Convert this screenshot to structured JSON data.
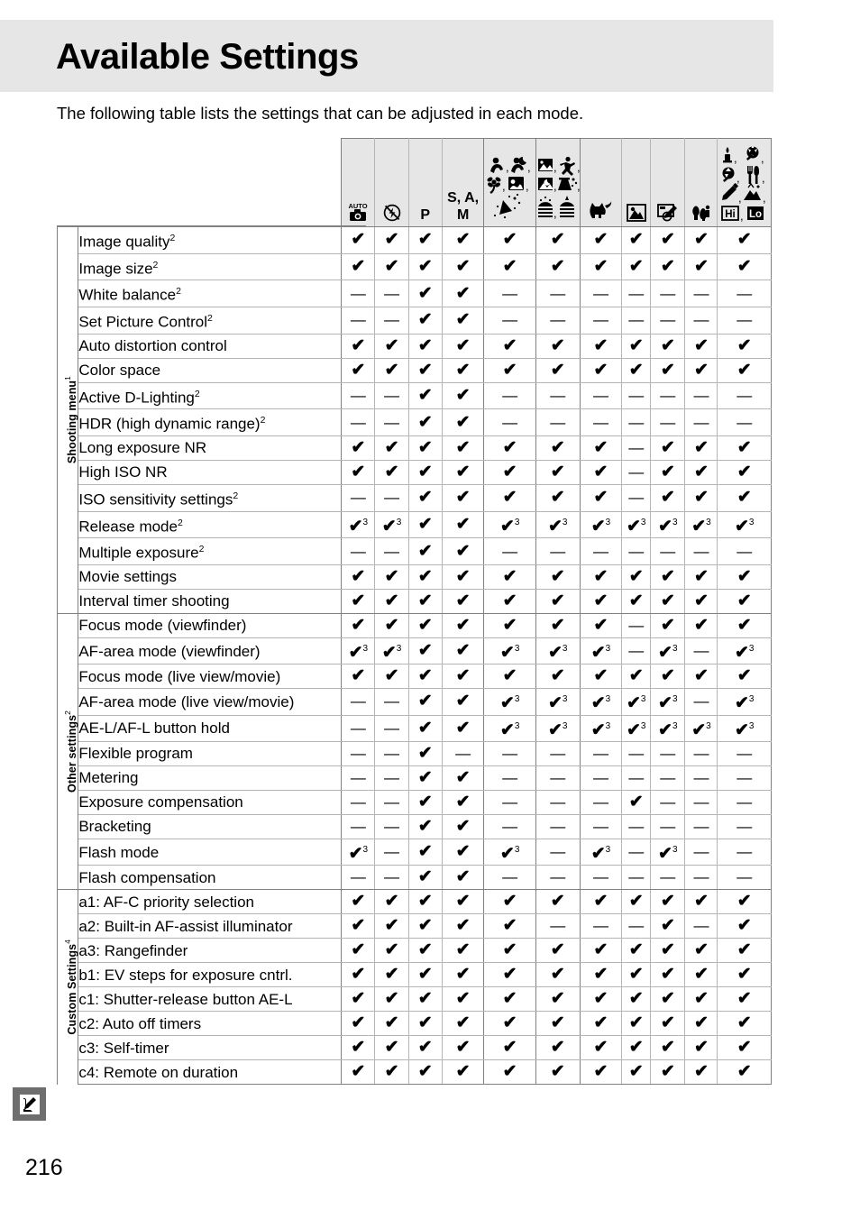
{
  "page": {
    "title": "Available Settings",
    "intro": "The following table lists the settings that can be adjusted in each mode.",
    "number": "216",
    "badge_icon": "pencil-note-icon",
    "accent_band": "#e6e6e6",
    "rule_color": "#808080"
  },
  "table": {
    "columns": [
      {
        "id": "auto",
        "icons": [
          "AUTO camera"
        ],
        "text": ""
      },
      {
        "id": "auto_noflash",
        "icons": [
          "flash-off"
        ],
        "text": ""
      },
      {
        "id": "p",
        "icons": [],
        "text": "P"
      },
      {
        "id": "sam",
        "icons": [],
        "text": "S, A, M"
      },
      {
        "id": "scene1",
        "icons": [
          "portrait",
          "night-portrait",
          "close-up",
          "child",
          "party"
        ],
        "text": ""
      },
      {
        "id": "scene2",
        "icons": [
          "landscape",
          "sports",
          "night-landscape",
          "candlelight",
          "beach",
          "sunset"
        ],
        "text": ""
      },
      {
        "id": "petportrait",
        "icons": [
          "pet-portrait"
        ],
        "text": ""
      },
      {
        "id": "effect_nightvision",
        "icons": [
          "night-vision"
        ],
        "text": ""
      },
      {
        "id": "effect_colorsketch",
        "icons": [
          "color-sketch"
        ],
        "text": ""
      },
      {
        "id": "effect_miniature",
        "icons": [
          "miniature-effect"
        ],
        "text": ""
      },
      {
        "id": "effect_group",
        "icons": [
          "candlelight",
          "blossom",
          "autumn",
          "food",
          "selective-color",
          "silhouette",
          "high-key",
          "low-key"
        ],
        "text": ""
      }
    ],
    "sections": [
      {
        "label": "Shooting menu",
        "label_sup": "1",
        "rows": [
          {
            "name": "Image quality",
            "sup": "2",
            "cells": [
              "y",
              "y",
              "y",
              "y",
              "y",
              "y",
              "y",
              "y",
              "y",
              "y",
              "y"
            ]
          },
          {
            "name": "Image size",
            "sup": "2",
            "cells": [
              "y",
              "y",
              "y",
              "y",
              "y",
              "y",
              "y",
              "y",
              "y",
              "y",
              "y"
            ]
          },
          {
            "name": "White balance",
            "sup": "2",
            "cells": [
              "n",
              "n",
              "y",
              "y",
              "n",
              "n",
              "n",
              "n",
              "n",
              "n",
              "n"
            ]
          },
          {
            "name": "Set Picture Control",
            "sup": "2",
            "cells": [
              "n",
              "n",
              "y",
              "y",
              "n",
              "n",
              "n",
              "n",
              "n",
              "n",
              "n"
            ]
          },
          {
            "name": "Auto distortion control",
            "sup": "",
            "cells": [
              "y",
              "y",
              "y",
              "y",
              "y",
              "y",
              "y",
              "y",
              "y",
              "y",
              "y"
            ]
          },
          {
            "name": "Color space",
            "sup": "",
            "cells": [
              "y",
              "y",
              "y",
              "y",
              "y",
              "y",
              "y",
              "y",
              "y",
              "y",
              "y"
            ]
          },
          {
            "name": "Active D-Lighting",
            "sup": "2",
            "cells": [
              "n",
              "n",
              "y",
              "y",
              "n",
              "n",
              "n",
              "n",
              "n",
              "n",
              "n"
            ]
          },
          {
            "name": "HDR (high dynamic range)",
            "sup": "2",
            "cells": [
              "n",
              "n",
              "y",
              "y",
              "n",
              "n",
              "n",
              "n",
              "n",
              "n",
              "n"
            ]
          },
          {
            "name": "Long exposure NR",
            "sup": "",
            "cells": [
              "y",
              "y",
              "y",
              "y",
              "y",
              "y",
              "y",
              "n",
              "y",
              "y",
              "y"
            ]
          },
          {
            "name": "High ISO NR",
            "sup": "",
            "cells": [
              "y",
              "y",
              "y",
              "y",
              "y",
              "y",
              "y",
              "n",
              "y",
              "y",
              "y"
            ]
          },
          {
            "name": "ISO sensitivity settings",
            "sup": "2",
            "cells": [
              "n",
              "n",
              "y",
              "y",
              "y",
              "y",
              "y",
              "n",
              "y",
              "y",
              "y"
            ]
          },
          {
            "name": "Release mode",
            "sup": "2",
            "cells": [
              "y3",
              "y3",
              "y",
              "y",
              "y3",
              "y3",
              "y3",
              "y3",
              "y3",
              "y3",
              "y3"
            ]
          },
          {
            "name": "Multiple exposure",
            "sup": "2",
            "cells": [
              "n",
              "n",
              "y",
              "y",
              "n",
              "n",
              "n",
              "n",
              "n",
              "n",
              "n"
            ]
          },
          {
            "name": "Movie settings",
            "sup": "",
            "cells": [
              "y",
              "y",
              "y",
              "y",
              "y",
              "y",
              "y",
              "y",
              "y",
              "y",
              "y"
            ]
          },
          {
            "name": "Interval timer shooting",
            "sup": "",
            "cells": [
              "y",
              "y",
              "y",
              "y",
              "y",
              "y",
              "y",
              "y",
              "y",
              "y",
              "y"
            ]
          }
        ]
      },
      {
        "label": "Other settings",
        "label_sup": "2",
        "rows": [
          {
            "name": "Focus mode (viewfinder)",
            "sup": "",
            "cells": [
              "y",
              "y",
              "y",
              "y",
              "y",
              "y",
              "y",
              "n",
              "y",
              "y",
              "y"
            ]
          },
          {
            "name": "AF-area mode (viewfinder)",
            "sup": "",
            "cells": [
              "y3",
              "y3",
              "y",
              "y",
              "y3",
              "y3",
              "y3",
              "n",
              "y3",
              "n",
              "y3"
            ]
          },
          {
            "name": "Focus mode (live view/movie)",
            "sup": "",
            "cells": [
              "y",
              "y",
              "y",
              "y",
              "y",
              "y",
              "y",
              "y",
              "y",
              "y",
              "y"
            ]
          },
          {
            "name": "AF-area mode (live view/movie)",
            "sup": "",
            "cells": [
              "n",
              "n",
              "y",
              "y",
              "y3",
              "y3",
              "y3",
              "y3",
              "y3",
              "n",
              "y3"
            ]
          },
          {
            "name": "AE-L/AF-L button hold",
            "sup": "",
            "cells": [
              "n",
              "n",
              "y",
              "y",
              "y3",
              "y3",
              "y3",
              "y3",
              "y3",
              "y3",
              "y3"
            ]
          },
          {
            "name": "Flexible program",
            "sup": "",
            "cells": [
              "n",
              "n",
              "y",
              "n",
              "n",
              "n",
              "n",
              "n",
              "n",
              "n",
              "n"
            ]
          },
          {
            "name": "Metering",
            "sup": "",
            "cells": [
              "n",
              "n",
              "y",
              "y",
              "n",
              "n",
              "n",
              "n",
              "n",
              "n",
              "n"
            ]
          },
          {
            "name": "Exposure compensation",
            "sup": "",
            "cells": [
              "n",
              "n",
              "y",
              "y",
              "n",
              "n",
              "n",
              "y",
              "n",
              "n",
              "n"
            ]
          },
          {
            "name": "Bracketing",
            "sup": "",
            "cells": [
              "n",
              "n",
              "y",
              "y",
              "n",
              "n",
              "n",
              "n",
              "n",
              "n",
              "n"
            ]
          },
          {
            "name": "Flash mode",
            "sup": "",
            "cells": [
              "y3",
              "n",
              "y",
              "y",
              "y3",
              "n",
              "y3",
              "n",
              "y3",
              "n",
              "n"
            ]
          },
          {
            "name": "Flash compensation",
            "sup": "",
            "cells": [
              "n",
              "n",
              "y",
              "y",
              "n",
              "n",
              "n",
              "n",
              "n",
              "n",
              "n"
            ]
          }
        ]
      },
      {
        "label": "Custom Settings",
        "label_sup": "4",
        "rows": [
          {
            "name": "a1: AF-C priority selection",
            "sup": "",
            "cells": [
              "y",
              "y",
              "y",
              "y",
              "y",
              "y",
              "y",
              "y",
              "y",
              "y",
              "y"
            ]
          },
          {
            "name": "a2: Built-in AF-assist illuminator",
            "sup": "",
            "cells": [
              "y",
              "y",
              "y",
              "y",
              "y",
              "n",
              "n",
              "n",
              "y",
              "n",
              "y"
            ]
          },
          {
            "name": "a3: Rangefinder",
            "sup": "",
            "cells": [
              "y",
              "y",
              "y",
              "y",
              "y",
              "y",
              "y",
              "y",
              "y",
              "y",
              "y"
            ]
          },
          {
            "name": "b1: EV steps for exposure cntrl.",
            "sup": "",
            "cells": [
              "y",
              "y",
              "y",
              "y",
              "y",
              "y",
              "y",
              "y",
              "y",
              "y",
              "y"
            ]
          },
          {
            "name": "c1: Shutter-release button AE-L",
            "sup": "",
            "cells": [
              "y",
              "y",
              "y",
              "y",
              "y",
              "y",
              "y",
              "y",
              "y",
              "y",
              "y"
            ]
          },
          {
            "name": "c2: Auto off timers",
            "sup": "",
            "cells": [
              "y",
              "y",
              "y",
              "y",
              "y",
              "y",
              "y",
              "y",
              "y",
              "y",
              "y"
            ]
          },
          {
            "name": "c3: Self-timer",
            "sup": "",
            "cells": [
              "y",
              "y",
              "y",
              "y",
              "y",
              "y",
              "y",
              "y",
              "y",
              "y",
              "y"
            ]
          },
          {
            "name": "c4: Remote on duration",
            "sup": "",
            "cells": [
              "y",
              "y",
              "y",
              "y",
              "y",
              "y",
              "y",
              "y",
              "y",
              "y",
              "y"
            ]
          }
        ]
      }
    ],
    "marks": {
      "yes": "✔",
      "no": "—",
      "note3": "3"
    }
  }
}
